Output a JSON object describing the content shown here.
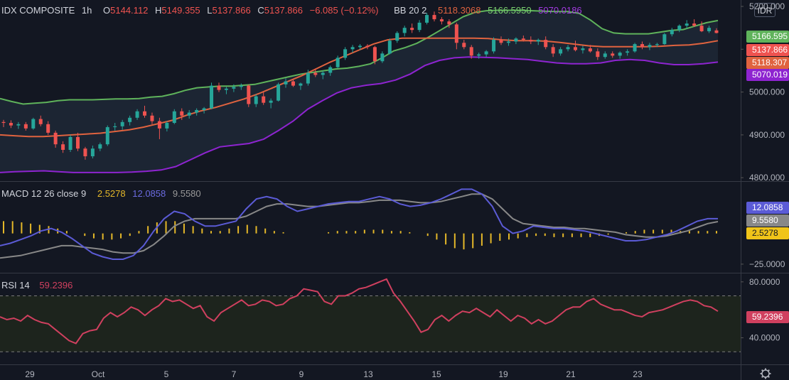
{
  "chart_data": {
    "type": "candlestick",
    "symbol": "IDX COMPOSITE",
    "interval": "1h",
    "currency": "IDR",
    "ohlc": {
      "open": "5144.112",
      "high": "5149.355",
      "low": "5137.866",
      "close": "5137.866",
      "change": "−6.085 (−0.12%)"
    },
    "bb": {
      "label": "BB 20 2",
      "basis": "5118.3068",
      "upper": "5166.5950",
      "lower": "5070.0186"
    },
    "badges": {
      "upper": "5166.595",
      "close": "5137.866",
      "basis": "5118.307",
      "lower": "5070.019"
    },
    "price_ticks": [
      "5200.000",
      "5100.000",
      "5000.000",
      "4900.000",
      "4800.000"
    ],
    "price_tick_values": [
      5200,
      5100,
      5000,
      4900,
      4800
    ],
    "price_range": [
      4792,
      5215
    ],
    "x_ticks": [
      "29",
      "Oct",
      "5",
      "7",
      "9",
      "13",
      "15",
      "19",
      "21",
      "23"
    ],
    "candles": [
      [
        4930,
        4935,
        4918,
        4928
      ],
      [
        4928,
        4934,
        4916,
        4922
      ],
      [
        4922,
        4930,
        4914,
        4925
      ],
      [
        4925,
        4930,
        4910,
        4915
      ],
      [
        4915,
        4940,
        4912,
        4937
      ],
      [
        4937,
        4945,
        4920,
        4925
      ],
      [
        4925,
        4932,
        4900,
        4905
      ],
      [
        4905,
        4910,
        4870,
        4878
      ],
      [
        4878,
        4885,
        4858,
        4865
      ],
      [
        4865,
        4900,
        4860,
        4895
      ],
      [
        4895,
        4905,
        4862,
        4868
      ],
      [
        4868,
        4872,
        4842,
        4850
      ],
      [
        4850,
        4875,
        4845,
        4868
      ],
      [
        4868,
        4882,
        4862,
        4878
      ],
      [
        4878,
        4922,
        4874,
        4918
      ],
      [
        4918,
        4928,
        4910,
        4920
      ],
      [
        4920,
        4935,
        4912,
        4930
      ],
      [
        4930,
        4945,
        4922,
        4940
      ],
      [
        4940,
        4960,
        4935,
        4955
      ],
      [
        4955,
        4968,
        4940,
        4945
      ],
      [
        4945,
        4952,
        4925,
        4932
      ],
      [
        4932,
        4940,
        4890,
        4915
      ],
      [
        4915,
        4932,
        4908,
        4928
      ],
      [
        4928,
        4960,
        4925,
        4955
      ],
      [
        4955,
        4962,
        4935,
        4945
      ],
      [
        4945,
        4958,
        4938,
        4952
      ],
      [
        4952,
        4962,
        4945,
        4958
      ],
      [
        4958,
        4965,
        4950,
        4962
      ],
      [
        4962,
        5022,
        4960,
        5015
      ],
      [
        5015,
        5022,
        5000,
        5005
      ],
      [
        5005,
        5012,
        4995,
        5008
      ],
      [
        5008,
        5018,
        5000,
        5012
      ],
      [
        5012,
        5020,
        5005,
        5015
      ],
      [
        5015,
        5018,
        4965,
        4972
      ],
      [
        4972,
        4995,
        4965,
        4990
      ],
      [
        4990,
        5000,
        4970,
        4975
      ],
      [
        4975,
        4985,
        4962,
        4980
      ],
      [
        4980,
        5022,
        4978,
        5018
      ],
      [
        5018,
        5032,
        5010,
        5025
      ],
      [
        5025,
        5030,
        5012,
        5015
      ],
      [
        5015,
        5022,
        5005,
        5020
      ],
      [
        5020,
        5052,
        5015,
        5045
      ],
      [
        5045,
        5055,
        5035,
        5040
      ],
      [
        5040,
        5050,
        5030,
        5045
      ],
      [
        5045,
        5062,
        5038,
        5058
      ],
      [
        5058,
        5085,
        5055,
        5080
      ],
      [
        5080,
        5105,
        5075,
        5100
      ],
      [
        5100,
        5110,
        5092,
        5105
      ],
      [
        5105,
        5112,
        5098,
        5108
      ],
      [
        5108,
        5112,
        5100,
        5105
      ],
      [
        5105,
        5108,
        5065,
        5072
      ],
      [
        5072,
        5095,
        5068,
        5090
      ],
      [
        5090,
        5125,
        5088,
        5120
      ],
      [
        5120,
        5142,
        5115,
        5138
      ],
      [
        5138,
        5155,
        5130,
        5150
      ],
      [
        5150,
        5160,
        5138,
        5145
      ],
      [
        5145,
        5168,
        5140,
        5162
      ],
      [
        5162,
        5185,
        5158,
        5180
      ],
      [
        5180,
        5188,
        5165,
        5170
      ],
      [
        5170,
        5175,
        5158,
        5165
      ],
      [
        5165,
        5170,
        5150,
        5158
      ],
      [
        5158,
        5162,
        5100,
        5115
      ],
      [
        5115,
        5122,
        5100,
        5105
      ],
      [
        5105,
        5110,
        5078,
        5085
      ],
      [
        5085,
        5092,
        5078,
        5088
      ],
      [
        5088,
        5098,
        5082,
        5095
      ],
      [
        5095,
        5128,
        5090,
        5122
      ],
      [
        5122,
        5130,
        5110,
        5115
      ],
      [
        5115,
        5125,
        5108,
        5118
      ],
      [
        5118,
        5128,
        5112,
        5125
      ],
      [
        5125,
        5132,
        5118,
        5122
      ],
      [
        5122,
        5130,
        5112,
        5118
      ],
      [
        5118,
        5125,
        5110,
        5122
      ],
      [
        5122,
        5130,
        5100,
        5105
      ],
      [
        5105,
        5112,
        5082,
        5090
      ],
      [
        5090,
        5105,
        5085,
        5100
      ],
      [
        5100,
        5110,
        5095,
        5105
      ],
      [
        5105,
        5120,
        5095,
        5098
      ],
      [
        5098,
        5108,
        5090,
        5102
      ],
      [
        5102,
        5110,
        5092,
        5095
      ],
      [
        5095,
        5102,
        5075,
        5082
      ],
      [
        5082,
        5095,
        5078,
        5090
      ],
      [
        5090,
        5095,
        5080,
        5085
      ],
      [
        5085,
        5095,
        5078,
        5092
      ],
      [
        5092,
        5100,
        5085,
        5095
      ],
      [
        5095,
        5115,
        5092,
        5112
      ],
      [
        5112,
        5118,
        5100,
        5105
      ],
      [
        5105,
        5115,
        5098,
        5110
      ],
      [
        5110,
        5115,
        5105,
        5112
      ],
      [
        5112,
        5138,
        5110,
        5135
      ],
      [
        5135,
        5150,
        5130,
        5145
      ],
      [
        5145,
        5158,
        5140,
        5155
      ],
      [
        5155,
        5168,
        5148,
        5160
      ],
      [
        5160,
        5170,
        5152,
        5155
      ],
      [
        5155,
        5165,
        5140,
        5142
      ],
      [
        5142,
        5155,
        5138,
        5150
      ],
      [
        5144,
        5149,
        5137,
        5138
      ]
    ],
    "bb_upper": [
      4985,
      4978,
      4972,
      4974,
      4976,
      4980,
      4982,
      4982,
      4982,
      4983,
      4984,
      4984,
      4985,
      4988,
      4990,
      4996,
      5004,
      5010,
      5012,
      5014,
      5014,
      5016,
      5018,
      5024,
      5030,
      5036,
      5042,
      5046,
      5050,
      5054,
      5056,
      5060,
      5066,
      5080,
      5096,
      5104,
      5114,
      5128,
      5144,
      5160,
      5176,
      5186,
      5190,
      5191,
      5191,
      5191,
      5190,
      5189,
      5188,
      5188,
      5184,
      5168,
      5148,
      5138,
      5136,
      5136,
      5136,
      5140,
      5144,
      5146,
      5154,
      5162,
      5167
    ],
    "bb_basis": [
      4900,
      4898,
      4896,
      4896,
      4898,
      4900,
      4902,
      4904,
      4908,
      4912,
      4918,
      4926,
      4934,
      4946,
      4956,
      4964,
      4974,
      4984,
      4996,
      5010,
      5024,
      5038,
      5054,
      5070,
      5084,
      5098,
      5112,
      5122,
      5126,
      5126,
      5126,
      5126,
      5126,
      5126,
      5125,
      5122,
      5120,
      5120,
      5119,
      5116,
      5112,
      5108,
      5106,
      5106,
      5106,
      5106,
      5107,
      5109,
      5110,
      5114,
      5120
    ],
    "bb_lower": [
      4812,
      4814,
      4815,
      4816,
      4814,
      4812,
      4812,
      4812,
      4812,
      4813,
      4815,
      4818,
      4826,
      4842,
      4858,
      4872,
      4876,
      4880,
      4890,
      4910,
      4932,
      4960,
      4980,
      4998,
      5010,
      5016,
      5020,
      5028,
      5042,
      5062,
      5074,
      5080,
      5082,
      5081,
      5080,
      5078,
      5076,
      5072,
      5068,
      5066,
      5066,
      5068,
      5074,
      5076,
      5074,
      5068,
      5064,
      5064,
      5066,
      5070
    ],
    "macd_label": "MACD 12 26 close 9",
    "macd_values": {
      "histogram": "2.5278",
      "macd": "12.0858",
      "signal": "9.5580"
    },
    "macd_badges": {
      "macd": "12.0858",
      "signal": "9.5580",
      "histogram": "2.5278"
    },
    "macd_ticks": [
      "−25.0000"
    ],
    "macd_tick_values": [
      -25
    ],
    "macd_range": [
      -32,
      42
    ],
    "macd_line": [
      -10,
      -8,
      -5,
      -2,
      2,
      4,
      1,
      -4,
      -10,
      -16,
      -19,
      -21,
      -21,
      -18,
      -10,
      2,
      12,
      18,
      16,
      10,
      6,
      6,
      8,
      10,
      20,
      28,
      30,
      28,
      22,
      18,
      20,
      22,
      24,
      25,
      26,
      26,
      28,
      30,
      28,
      24,
      22,
      23,
      25,
      28,
      32,
      36,
      36,
      32,
      22,
      6,
      0,
      2,
      6,
      5,
      4,
      4,
      3,
      2,
      0,
      -2,
      -4,
      -6,
      -6,
      -5,
      -3,
      -1,
      2,
      6,
      10,
      12,
      12
    ],
    "macd_signal": [
      -20,
      -19,
      -18,
      -16,
      -14,
      -12,
      -10,
      -10,
      -11,
      -12,
      -13,
      -15,
      -16,
      -16,
      -14,
      -9,
      -2,
      6,
      10,
      12,
      12,
      12,
      12,
      12,
      14,
      18,
      22,
      24,
      24,
      23,
      22,
      22,
      23,
      24,
      25,
      25,
      26,
      27,
      27,
      27,
      26,
      25,
      25,
      26,
      28,
      30,
      32,
      32,
      28,
      20,
      12,
      8,
      7,
      6,
      5,
      5,
      4,
      4,
      3,
      2,
      1,
      -1,
      -2,
      -3,
      -3,
      -2,
      0,
      2,
      5,
      8,
      9.6
    ],
    "macd_hist": [
      10,
      10,
      9,
      8,
      7,
      6,
      4,
      2,
      0,
      -2,
      -4,
      -5,
      -5,
      -4,
      -2,
      2,
      6,
      9,
      10,
      10,
      8,
      6,
      4,
      2,
      2,
      4,
      6,
      7,
      6,
      4,
      2,
      1,
      0,
      0,
      0,
      0,
      1,
      2,
      2,
      2,
      3,
      3,
      3,
      2,
      2,
      1,
      0,
      -2,
      -5,
      -9,
      -12,
      -13,
      -12,
      -10,
      -8,
      -6,
      -5,
      -4,
      -3,
      -2,
      -2,
      -3,
      -3,
      -3,
      -3,
      -3,
      -2,
      -1,
      0,
      1,
      2,
      3,
      3,
      3,
      3,
      2,
      2,
      2,
      2,
      2
    ],
    "rsi_label": "RSI 14",
    "rsi_value": "59.2396",
    "rsi_badge": "59.2396",
    "rsi_ticks": [
      "80.0000",
      "40.0000"
    ],
    "rsi_tick_values": [
      80,
      40
    ],
    "rsi_range": [
      21,
      86
    ],
    "rsi_levels": [
      70,
      30
    ],
    "rsi": [
      55,
      53,
      54,
      52,
      56,
      53,
      51,
      50,
      46,
      42,
      38,
      36,
      43,
      45,
      46,
      54,
      58,
      55,
      58,
      62,
      60,
      56,
      60,
      63,
      68,
      66,
      67,
      64,
      61,
      63,
      55,
      52,
      58,
      61,
      64,
      67,
      63,
      64,
      67,
      66,
      63,
      64,
      68,
      70,
      75,
      74,
      73,
      66,
      64,
      70,
      70,
      72,
      75,
      76,
      78,
      80,
      82,
      72,
      66,
      59,
      52,
      44,
      46,
      53,
      56,
      52,
      56,
      59,
      58,
      61,
      58,
      55,
      60,
      56,
      52,
      56,
      54,
      50,
      53,
      50,
      52,
      56,
      60,
      62,
      62,
      66,
      68,
      64,
      62,
      60,
      60,
      58,
      56,
      55,
      58,
      59,
      60,
      62,
      64,
      66,
      67,
      66,
      63,
      62,
      59
    ],
    "colors": {
      "up": "#26a69a",
      "down": "#ef5350",
      "bb_upper": "#5fb35b",
      "bb_basis": "#e0633f",
      "bb_lower": "#8e24d0",
      "macd": "#5b5bd6",
      "signal": "#888888",
      "hist": "#e5b829",
      "rsi": "#d0405f"
    }
  }
}
